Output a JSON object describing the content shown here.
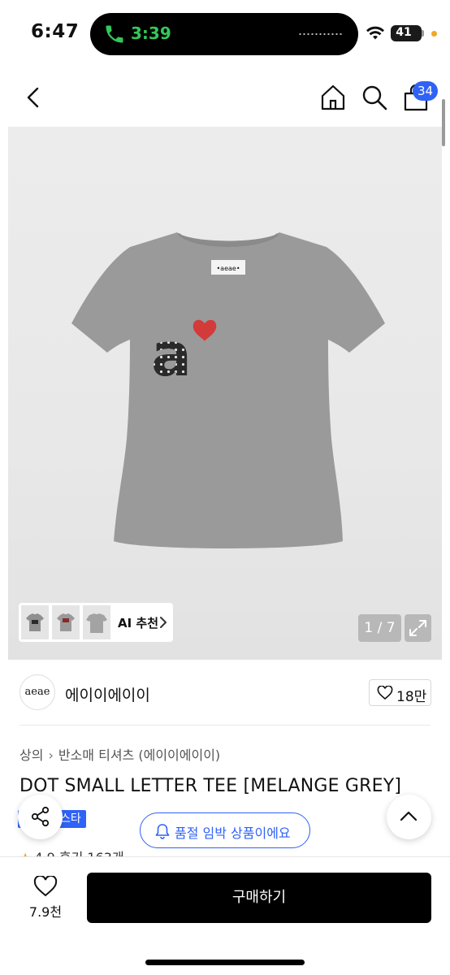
{
  "status_bar": {
    "time": "6:47",
    "call_duration": "3:39",
    "battery": "41",
    "call_color": "#34c759"
  },
  "nav": {
    "back_icon": "chevron-left-icon",
    "home_icon": "home-icon",
    "search_icon": "search-icon",
    "bag_icon": "shopping-bag-icon",
    "cart_count": "34"
  },
  "gallery": {
    "logo_text": "aeae",
    "ai_recommend_label": "AI 추천",
    "page_indicator": "1 / 7"
  },
  "brand": {
    "logo_text": "aeae",
    "name": "에이이에이이",
    "likes": "18만"
  },
  "product": {
    "breadcrumb": [
      "상의",
      "반소매 티셔츠 (에이이에이이)"
    ],
    "title": "DOT SMALL LETTER TEE [MELANGE GREY]",
    "tag": "스타",
    "rating": "4.9",
    "reviews": "후기 163개"
  },
  "floating": {
    "soldout_notice": "품절 임박 상품이에요"
  },
  "bottom_bar": {
    "wish_count": "7.9천",
    "buy_label": "구매하기"
  },
  "colors": {
    "accent": "#2f62f6",
    "buy_button": "#000000",
    "tee": "#9a9a9a"
  }
}
